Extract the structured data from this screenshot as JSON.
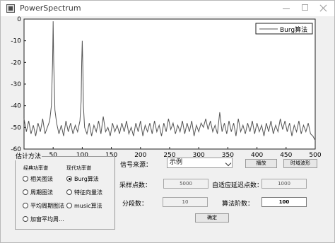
{
  "window": {
    "title": "PowerSpectrum"
  },
  "chart_data": {
    "type": "line",
    "xlim": [
      0,
      500
    ],
    "ylim": [
      -60,
      0
    ],
    "xticks": [
      0,
      50,
      100,
      150,
      200,
      250,
      300,
      350,
      400,
      450,
      500
    ],
    "yticks": [
      0,
      -10,
      -20,
      -30,
      -40,
      -50,
      -60
    ],
    "legend": "top-right",
    "grid": false,
    "line_color": "#555555",
    "series": [
      {
        "name": "Burg算法",
        "x": [
          0,
          4,
          8,
          12,
          16,
          20,
          24,
          28,
          32,
          36,
          40,
          44,
          47,
          49,
          50,
          51,
          53,
          56,
          60,
          64,
          68,
          72,
          76,
          80,
          84,
          88,
          92,
          96,
          98,
          99,
          100,
          101,
          102,
          104,
          108,
          112,
          116,
          120,
          124,
          128,
          132,
          136,
          140,
          144,
          148,
          152,
          156,
          160,
          164,
          168,
          172,
          176,
          180,
          184,
          188,
          192,
          196,
          200,
          204,
          208,
          212,
          216,
          220,
          224,
          228,
          232,
          236,
          240,
          244,
          248,
          252,
          256,
          260,
          264,
          268,
          272,
          276,
          280,
          284,
          288,
          292,
          296,
          300,
          304,
          308,
          312,
          316,
          320,
          324,
          328,
          332,
          336,
          340,
          344,
          348,
          352,
          356,
          360,
          364,
          368,
          372,
          376,
          380,
          384,
          388,
          392,
          396,
          400,
          404,
          408,
          412,
          416,
          420,
          424,
          428,
          432,
          436,
          440,
          444,
          448,
          452,
          456,
          460,
          464,
          468,
          472,
          476,
          480,
          484,
          488,
          492,
          496,
          500
        ],
        "y": [
          -46,
          -52,
          -47,
          -53,
          -49,
          -54,
          -48,
          -52,
          -46,
          -53,
          -50,
          -47,
          -40,
          -20,
          -1,
          -20,
          -42,
          -48,
          -53,
          -49,
          -54,
          -47,
          -52,
          -48,
          -53,
          -49,
          -52,
          -47,
          -38,
          -20,
          -10,
          -22,
          -40,
          -50,
          -53,
          -48,
          -54,
          -49,
          -52,
          -47,
          -53,
          -45,
          -52,
          -50,
          -54,
          -48,
          -52,
          -49,
          -53,
          -48,
          -52,
          -47,
          -53,
          -50,
          -54,
          -48,
          -52,
          -47,
          -54,
          -49,
          -52,
          -48,
          -53,
          -47,
          -52,
          -49,
          -54,
          -48,
          -52,
          -46,
          -51,
          -48,
          -53,
          -49,
          -52,
          -47,
          -53,
          -48,
          -52,
          -47,
          -54,
          -49,
          -52,
          -48,
          -50,
          -46,
          -51,
          -47,
          -52,
          -49,
          -53,
          -43,
          -52,
          -48,
          -53,
          -47,
          -52,
          -48,
          -54,
          -46,
          -52,
          -49,
          -53,
          -48,
          -52,
          -47,
          -53,
          -48,
          -52,
          -49,
          -54,
          -48,
          -52,
          -47,
          -53,
          -49,
          -52,
          -46,
          -51,
          -47,
          -52,
          -48,
          -54,
          -49,
          -52,
          -47,
          -53,
          -49,
          -52,
          -48,
          -53,
          -54,
          -56
        ]
      }
    ]
  },
  "panel": {
    "group_title": "估计方法",
    "classic_title": "经典功率谱",
    "modern_title": "现代功率谱",
    "options": [
      {
        "label": "相关图法",
        "selected": false
      },
      {
        "label": "周期图法",
        "selected": false
      },
      {
        "label": "平均周期图法",
        "selected": false
      },
      {
        "label": "加窗平均周...",
        "selected": false
      },
      {
        "label": "Burg算法",
        "selected": true
      },
      {
        "label": "特征向量法",
        "selected": false
      },
      {
        "label": "music算法",
        "selected": false
      }
    ]
  },
  "controls": {
    "signal_source_label": "信号来源：",
    "signal_source_value": "示例",
    "play_button": "播放",
    "waveform_button": "时域波形",
    "sample_points_label": "采样点数：",
    "sample_points_value": "5000",
    "adaptive_delay_label": "自适应延迟点数：",
    "adaptive_delay_value": "1000",
    "segments_label": "分段数：",
    "segments_value": "10",
    "order_label": "算法阶数：",
    "order_value": "100",
    "confirm_button": "确定"
  }
}
